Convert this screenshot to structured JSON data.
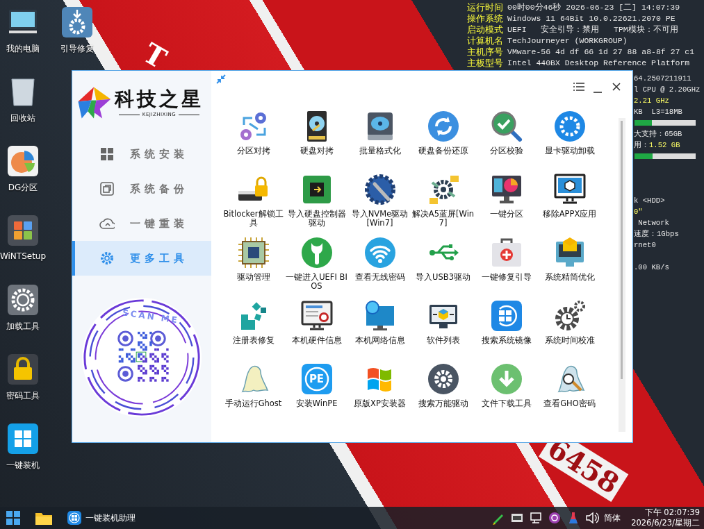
{
  "desktop_icons": [
    {
      "label": "我的电脑"
    },
    {
      "label": "引导修复"
    },
    {
      "label": "回收站"
    },
    {
      "label": "DG分区"
    },
    {
      "label": "WiNTSetup"
    },
    {
      "label": "加载工具"
    },
    {
      "label": "密码工具"
    },
    {
      "label": "一键装机"
    }
  ],
  "wallpaper_text": [
    "T",
    "6458"
  ],
  "system_info": {
    "rows": [
      {
        "label": "运行时间",
        "value": "00时00分46秒 2026-06-23 [二] 14:07:39"
      },
      {
        "label": "操作系统",
        "value": "Windows 11 64Bit 10.0.22621.2070 PE"
      },
      {
        "label": "启动模式",
        "value": "UEFI   安全引导：禁用   TPM模块：不可用"
      },
      {
        "label": "计算机名",
        "value": "TechJourneyer (WORKGROUP)"
      },
      {
        "label": "主机序号",
        "value": "VMware-56 4d df 66 1d 27 88 a8-8f 27 c1"
      },
      {
        "label": "主板型号",
        "value": "Intel 440BX Desktop Reference Platform"
      }
    ],
    "fragments": [
      {
        "kind": "text",
        "parts": [
          {
            "text": "64.2507211911",
            "highlight": false
          }
        ]
      },
      {
        "kind": "text",
        "parts": [
          {
            "text": "l CPU @ 2.20GHz",
            "highlight": false
          }
        ]
      },
      {
        "kind": "text",
        "parts": [
          {
            "text": "2.21 GHz",
            "highlight": true
          }
        ]
      },
      {
        "kind": "text",
        "parts": [
          {
            "text": "KB  L3=18MB",
            "highlight": false
          }
        ]
      },
      {
        "kind": "bar",
        "level": 0.28
      },
      {
        "kind": "text",
        "parts": [
          {
            "text": "大支持：65GB",
            "highlight": false
          }
        ]
      },
      {
        "kind": "text",
        "parts": [
          {
            "text": "用：",
            "highlight": false
          },
          {
            "text": "1.52 GB",
            "highlight": true
          }
        ]
      },
      {
        "kind": "bar",
        "level": 0.3
      },
      {
        "kind": "text",
        "parts": [
          {
            "text": "k <HDD>",
            "highlight": false
          }
        ]
      },
      {
        "kind": "text",
        "parts": [
          {
            "text": "0\"",
            "highlight": true
          }
        ]
      },
      {
        "kind": "text",
        "parts": [
          {
            "text": " Network",
            "highlight": false
          }
        ]
      },
      {
        "kind": "text",
        "parts": [
          {
            "text": "速度：1Gbps",
            "highlight": false
          }
        ]
      },
      {
        "kind": "text",
        "parts": [
          {
            "text": "rnet0",
            "highlight": false
          }
        ]
      },
      {
        "kind": "text",
        "parts": [
          {
            "text": ".00 KB/s",
            "highlight": false
          }
        ]
      }
    ]
  },
  "window": {
    "logo": {
      "title": "科技之星",
      "subtitle": "KEJIZHIXING"
    },
    "nav": [
      {
        "label": "系统安装",
        "selected": false
      },
      {
        "label": "系统备份",
        "selected": false
      },
      {
        "label": "一键重装",
        "selected": false
      },
      {
        "label": "更多工具",
        "selected": true
      }
    ],
    "qr": {
      "caption": "SCAN ME"
    },
    "tools": [
      {
        "label": "分区对拷"
      },
      {
        "label": "硬盘对拷"
      },
      {
        "label": "批量格式化"
      },
      {
        "label": "硬盘备份还原"
      },
      {
        "label": "分区校验"
      },
      {
        "label": "显卡驱动卸载"
      },
      {
        "label": "Bitlocker解锁工具"
      },
      {
        "label": "导入硬盘控制器驱动"
      },
      {
        "label": "导入NVMe驱动[Win7]"
      },
      {
        "label": "解决A5蓝屏[Win7]"
      },
      {
        "label": "一键分区"
      },
      {
        "label": "移除APPX应用"
      },
      {
        "label": "驱动管理"
      },
      {
        "label": "一键进入UEFI BIOS"
      },
      {
        "label": "查看无线密码"
      },
      {
        "label": "导入USB3驱动"
      },
      {
        "label": "一键修复引导"
      },
      {
        "label": "系统精简优化"
      },
      {
        "label": "注册表修复"
      },
      {
        "label": "本机硬件信息"
      },
      {
        "label": "本机网络信息"
      },
      {
        "label": "软件列表"
      },
      {
        "label": "搜索系统镜像"
      },
      {
        "label": "系统时间校准"
      },
      {
        "label": "手动运行Ghost"
      },
      {
        "label": "安装WinPE",
        "badge": "PE"
      },
      {
        "label": "原版XP安装器"
      },
      {
        "label": "搜索万能驱动"
      },
      {
        "label": "文件下载工具"
      },
      {
        "label": "查看GHO密码"
      }
    ]
  },
  "taskbar": {
    "apps": [
      {
        "label": "一键装机助理"
      }
    ],
    "language": "简体",
    "time": "下午 02:07:39",
    "date": "2026/6/23/星期二"
  }
}
